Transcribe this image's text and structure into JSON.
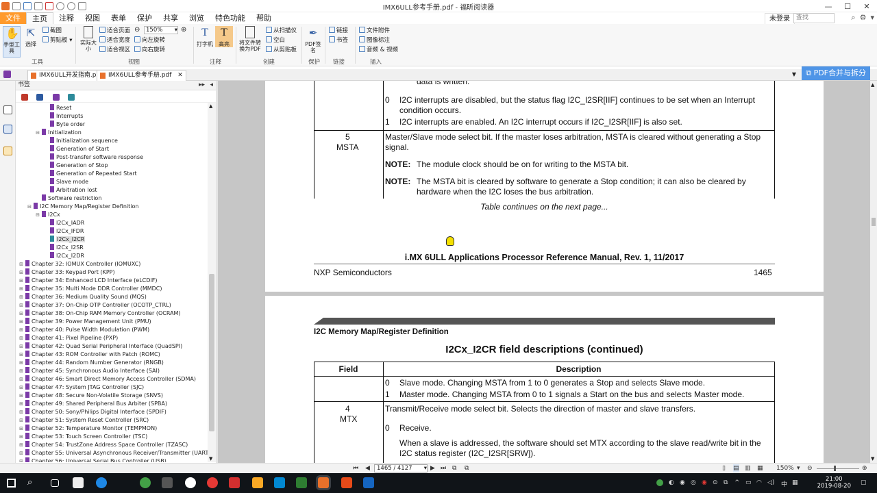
{
  "window": {
    "title": "IMX6ULL参考手册.pdf - 福昕阅读器"
  },
  "menu": {
    "tabs": [
      "文件",
      "主页",
      "注释",
      "视图",
      "表单",
      "保护",
      "共享",
      "浏览",
      "特色功能",
      "帮助"
    ],
    "login_label": "未登录",
    "search_placeholder": "查找"
  },
  "ribbon": {
    "hand_tool": "手型工具",
    "select": "选择",
    "screenshot": "截图",
    "clipboard": "剪贴板",
    "group_tools": "工具",
    "actual_size": "实际大小",
    "fit_page": "适合页面",
    "fit_width": "适合宽度",
    "fit_visible": "适合视区",
    "zoom_value": "150%",
    "rotate_left": "向左旋转",
    "rotate_right": "向右旋转",
    "group_view": "视图",
    "typewriter": "打字机",
    "highlight": "高亮",
    "group_comment": "注释",
    "convert_pdf": "将文件转换为PDF",
    "from_scanner": "从扫描仪",
    "blank": "空白",
    "from_clipboard": "从剪贴板",
    "group_create": "创建",
    "pdf_sign": "PDF签名",
    "group_protect": "保护",
    "link": "链接",
    "bookmark": "书签",
    "group_links": "链接",
    "file_attachment": "文件附件",
    "image_annotation": "图像标注",
    "audio_video": "音频 & 视频",
    "group_insert": "插入"
  },
  "doc_tabs": [
    {
      "label": "IMX6ULL开发指南.pdf"
    },
    {
      "label": "IMX6ULL参考手册.pdf"
    }
  ],
  "merge_button": "PDF合并与拆分",
  "bookmarks": {
    "header": "书签",
    "items": [
      {
        "label": "Reset",
        "level": 3
      },
      {
        "label": "Interrupts",
        "level": 3
      },
      {
        "label": "Byte order",
        "level": 3
      },
      {
        "label": "Initialization",
        "level": 2,
        "expanded": true
      },
      {
        "label": "Initialization sequence",
        "level": 3
      },
      {
        "label": "Generation of Start",
        "level": 3
      },
      {
        "label": "Post-transfer software response",
        "level": 3
      },
      {
        "label": "Generation of Stop",
        "level": 3
      },
      {
        "label": "Generation of Repeated Start",
        "level": 3
      },
      {
        "label": "Slave mode",
        "level": 3
      },
      {
        "label": "Arbitration lost",
        "level": 3
      },
      {
        "label": "Software restriction",
        "level": 2
      },
      {
        "label": "I2C Memory Map/Register Definition",
        "level": 1,
        "expanded": true
      },
      {
        "label": "I2Cx",
        "level": 2,
        "expanded": true
      },
      {
        "label": "I2Cx_IADR",
        "level": 3
      },
      {
        "label": "I2Cx_IFDR",
        "level": 3
      },
      {
        "label": "I2Cx_I2CR",
        "level": 3,
        "selected": true
      },
      {
        "label": "I2Cx_I2SR",
        "level": 3
      },
      {
        "label": "I2Cx_I2DR",
        "level": 3
      },
      {
        "label": "Chapter 32: IOMUX Controller (IOMUXC)",
        "level": 0
      },
      {
        "label": "Chapter 33: Keypad Port (KPP)",
        "level": 0
      },
      {
        "label": "Chapter 34: Enhanced LCD Interface (eLCDIF)",
        "level": 0
      },
      {
        "label": "Chapter 35: Multi Mode DDR Controller (MMDC)",
        "level": 0
      },
      {
        "label": "Chapter 36: Medium Quality Sound (MQS)",
        "level": 0
      },
      {
        "label": "Chapter 37: On-Chip OTP Controller (OCOTP_CTRL)",
        "level": 0
      },
      {
        "label": "Chapter 38: On-Chip RAM Memory Controller (OCRAM)",
        "level": 0
      },
      {
        "label": "Chapter 39: Power Management Unit (PMU)",
        "level": 0
      },
      {
        "label": "Chapter 40: Pulse Width Modulation (PWM)",
        "level": 0
      },
      {
        "label": "Chapter 41: Pixel Pipeline (PXP)",
        "level": 0
      },
      {
        "label": "Chapter 42: Quad Serial Peripheral Interface (QuadSPI)",
        "level": 0
      },
      {
        "label": "Chapter 43: ROM Controller with Patch (ROMC)",
        "level": 0
      },
      {
        "label": "Chapter 44: Random Number Generator (RNGB)",
        "level": 0
      },
      {
        "label": "Chapter 45: Synchronous Audio Interface (SAI)",
        "level": 0
      },
      {
        "label": "Chapter 46: Smart Direct Memory Access Controller (SDMA)",
        "level": 0
      },
      {
        "label": "Chapter 47: System JTAG Controller (SJC)",
        "level": 0
      },
      {
        "label": "Chapter 48: Secure Non-Volatile Storage (SNVS)",
        "level": 0
      },
      {
        "label": "Chapter 49: Shared Peripheral Bus Arbiter (SPBA)",
        "level": 0
      },
      {
        "label": "Chapter 50: Sony/Philips Digital Interface (SPDIF)",
        "level": 0
      },
      {
        "label": "Chapter 51: System Reset Controller (SRC)",
        "level": 0
      },
      {
        "label": "Chapter 52: Temperature Monitor (TEMPMON)",
        "level": 0
      },
      {
        "label": "Chapter 53: Touch Screen Controller (TSC)",
        "level": 0
      },
      {
        "label": "Chapter 54: TrustZone Address Space Controller (TZASC)",
        "level": 0
      },
      {
        "label": "Chapter 55: Universal Asynchronous Receiver/Transmitter (UART)",
        "level": 0
      },
      {
        "label": "Chapter 56: Universal Serial Bus Controller (USB)",
        "level": 0
      }
    ]
  },
  "page1": {
    "row_top_text": "data is written.",
    "row6_0_num": "0",
    "row6_0_text1": "I2C interrupts are disabled, but the status flag I2C_I2SR[IIF] continues to be set when an Interrupt",
    "row6_0_text2": "condition occurs.",
    "row6_1_num": "1",
    "row6_1_text": "I2C interrupts are enabled. An I2C interrupt occurs if I2C_I2SR[IIF] is also set.",
    "field5_num": "5",
    "field5_name": "MSTA",
    "field5_desc1": "Master/Slave mode select bit. If the master loses arbitration, MSTA is cleared without generating a Stop",
    "field5_desc2": "signal.",
    "note_label": "NOTE:",
    "note1": "The module clock should be on for writing to the MSTA bit.",
    "note2_1": "The MSTA bit is cleared by software to generate a Stop condition; it can also be cleared by",
    "note2_2": "hardware when the I2C loses the bus arbitration.",
    "continues": "Table continues on the next page...",
    "footer_title": "i.MX 6ULL Applications Processor Reference Manual, Rev. 1, 11/2017",
    "footer_left": "NXP Semiconductors",
    "footer_page": "1465"
  },
  "page2": {
    "section": "I2C Memory Map/Register Definition",
    "table_title": "I2Cx_I2CR field descriptions (continued)",
    "col_field": "Field",
    "col_desc": "Description",
    "r0_num": "0",
    "r0_text": "Slave mode. Changing MSTA from 1 to 0 generates a Stop and selects Slave mode.",
    "r1_num": "1",
    "r1_text": "Master mode. Changing MSTA from 0 to 1 signals a Start on the bus and selects Master mode.",
    "field4_num": "4",
    "field4_name": "MTX",
    "field4_desc": "Transmit/Receive mode select bit. Selects the direction of master and slave transfers.",
    "f4_0_num": "0",
    "f4_0_text": "Receive.",
    "f4_0_detail1": "When a slave is addressed, the software should set MTX according to the slave read/write bit in the",
    "f4_0_detail2": "I2C status register (I2C_I2SR[SRW])."
  },
  "statusbar": {
    "page_indicator": "1465 / 4127",
    "zoom": "150%"
  },
  "taskbar": {
    "time": "21:00",
    "date": "2019-08-20",
    "lang": "中"
  },
  "colors": {
    "accent_orange": "#ff9a2c",
    "merge_blue": "#4f95e7",
    "bookmark_purple": "#7b3aa7",
    "taskbar": "#101418"
  }
}
